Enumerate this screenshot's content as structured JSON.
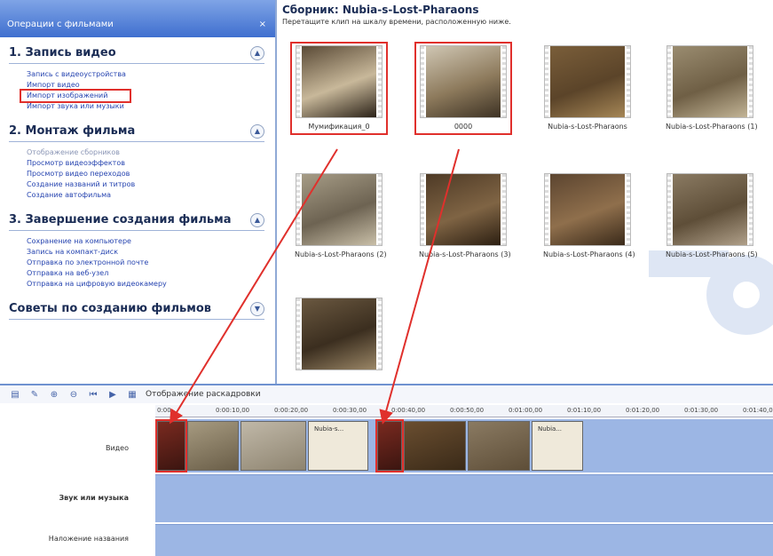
{
  "taskpane": {
    "header": "Операции с фильмами",
    "close": "×",
    "sections": [
      {
        "title": "1. Запись видео",
        "links": [
          {
            "label": "Запись с видеоустройства",
            "dim": false,
            "highlight": false
          },
          {
            "label": "Импорт видео",
            "dim": false,
            "highlight": false
          },
          {
            "label": "Импорт изображений",
            "dim": false,
            "highlight": true
          },
          {
            "label": "Импорт звука или музыки",
            "dim": false,
            "highlight": false
          }
        ]
      },
      {
        "title": "2. Монтаж фильма",
        "links": [
          {
            "label": "Отображение сборников",
            "dim": true,
            "highlight": false
          },
          {
            "label": "Просмотр видеоэффектов",
            "dim": false,
            "highlight": false
          },
          {
            "label": "Просмотр видео переходов",
            "dim": false,
            "highlight": false
          },
          {
            "label": "Создание названий и титров",
            "dim": false,
            "highlight": false
          },
          {
            "label": "Создание автофильма",
            "dim": false,
            "highlight": false
          }
        ]
      },
      {
        "title": "3. Завершение создания фильма",
        "links": [
          {
            "label": "Сохранение на компьютере",
            "dim": false,
            "highlight": false
          },
          {
            "label": "Запись на компакт-диск",
            "dim": false,
            "highlight": false
          },
          {
            "label": "Отправка по электронной почте",
            "dim": false,
            "highlight": false
          },
          {
            "label": "Отправка на веб-узел",
            "dim": false,
            "highlight": false
          },
          {
            "label": "Отправка на цифровую видеокамеру",
            "dim": false,
            "highlight": false
          }
        ]
      },
      {
        "title": "Советы по созданию фильмов",
        "links": []
      }
    ]
  },
  "collection": {
    "title": "Сборник: Nubia-s-Lost-Pharaons",
    "subtitle": "Перетащите клип на шкалу времени, расположенную ниже.",
    "clips": [
      {
        "label": "Мумификация_0",
        "colors": [
          "#5a4a36",
          "#c8b89a",
          "#2b2218"
        ],
        "selected": true
      },
      {
        "label": "0000",
        "colors": [
          "#cfc6b3",
          "#8d7a5c",
          "#3d3224"
        ],
        "selected": true
      },
      {
        "label": "Nubia-s-Lost-Pharaons",
        "colors": [
          "#7a5e3a",
          "#5b4429",
          "#a58656"
        ],
        "selected": false
      },
      {
        "label": "Nubia-s-Lost-Pharaons (1)",
        "colors": [
          "#9a8c70",
          "#6f5f45",
          "#c2b496"
        ],
        "selected": false
      },
      {
        "label": "Nubia-s-Lost-Pharaons (2)",
        "colors": [
          "#a69c86",
          "#6d6352",
          "#c9bfa8"
        ],
        "selected": false
      },
      {
        "label": "Nubia-s-Lost-Pharaons (3)",
        "colors": [
          "#4e3a26",
          "#7f6444",
          "#2c1f12"
        ],
        "selected": false
      },
      {
        "label": "Nubia-s-Lost-Pharaons (4)",
        "colors": [
          "#5c4530",
          "#8f6f4c",
          "#3a2a1a"
        ],
        "selected": false
      },
      {
        "label": "Nubia-s-Lost-Pharaons (5)",
        "colors": [
          "#8a7a62",
          "#5e4e38",
          "#b0a08a"
        ],
        "selected": false
      },
      {
        "label": "",
        "colors": [
          "#6a5840",
          "#3b2e1f",
          "#9a8666"
        ],
        "selected": false
      }
    ]
  },
  "timeline": {
    "toolbar_label": "Отображение раскадровки",
    "ruler": [
      "0:00",
      "0:00:10,00",
      "0:00:20,00",
      "0:00:30,00",
      "0:00:40,00",
      "0:00:50,00",
      "0:01:00,00",
      "0:01:10,00",
      "0:01:20,00",
      "0:01:30,00",
      "0:01:40,00"
    ],
    "tracks": {
      "video": "Видео",
      "audio": "Звук или музыка",
      "title": "Наложение названия"
    },
    "video_clips": [
      {
        "colors": [
          "#7a2a20",
          "#3b1510"
        ],
        "text": "",
        "selected": true
      },
      {
        "colors": [
          "#a69a80",
          "#6a5e48"
        ],
        "text": "",
        "selected": false
      },
      {
        "colors": [
          "#c0b8a8",
          "#8e8470"
        ],
        "text": "",
        "selected": false
      },
      {
        "colors": [
          "#efe9da",
          "#efe9da"
        ],
        "text": "Nubia-s...",
        "selected": false
      },
      {
        "colors": [
          "#7a2a20",
          "#3b1510"
        ],
        "text": "",
        "selected": true
      },
      {
        "colors": [
          "#6a4e30",
          "#3a2a18"
        ],
        "text": "",
        "selected": false
      },
      {
        "colors": [
          "#8a7a62",
          "#5e4e38"
        ],
        "text": "",
        "selected": false
      },
      {
        "colors": [
          "#efe9da",
          "#efe9da"
        ],
        "text": "Nubia...",
        "selected": false
      }
    ]
  },
  "colors": {
    "accent": "#e0302c",
    "track": "#9cb6e4",
    "link": "#2745b0"
  }
}
